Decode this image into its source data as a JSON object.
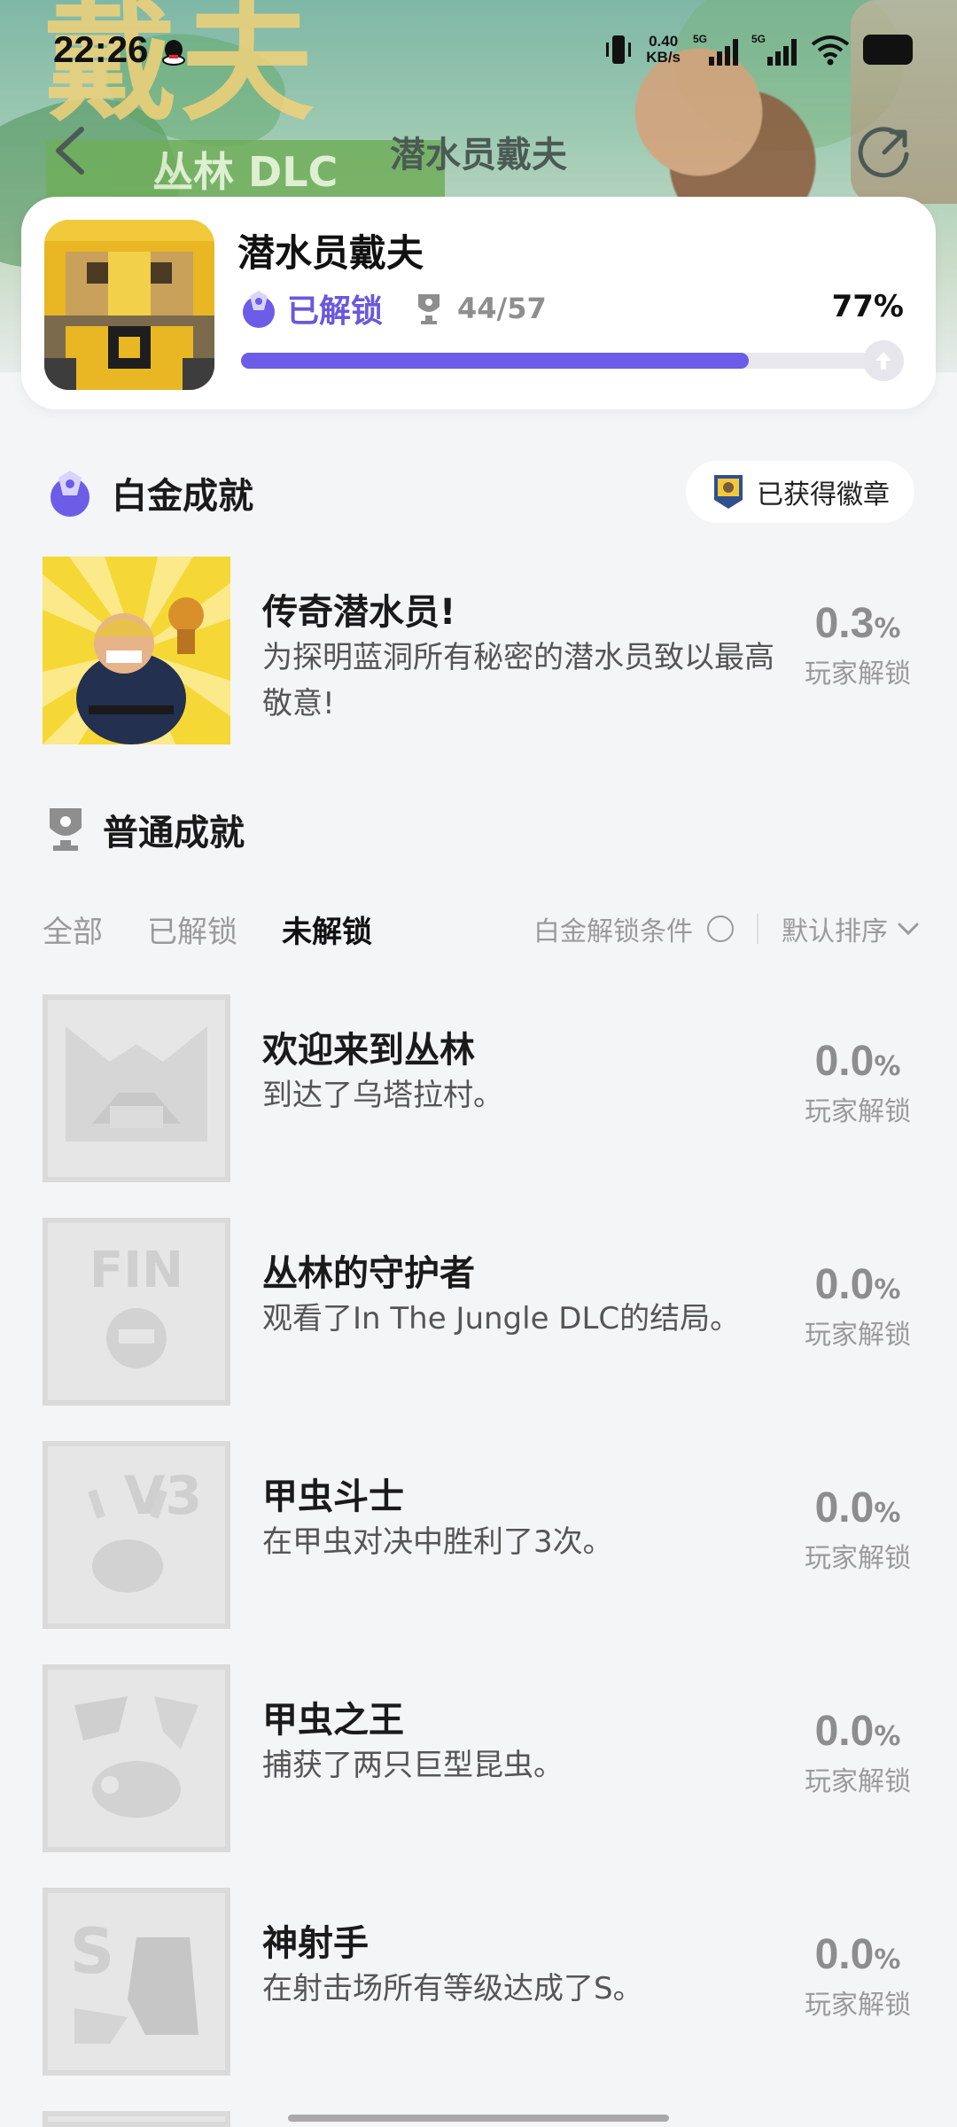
{
  "status_bar": {
    "time": "22:26",
    "net_speed_value": "0.40",
    "net_speed_unit": "KB/s",
    "sim1": "5G",
    "sim2": "5G"
  },
  "banner": {
    "logo_text": "戴夫",
    "dlc_label": "丛林 DLC"
  },
  "nav": {
    "title": "潜水员戴夫",
    "back_icon": "chevron-left-icon",
    "share_icon": "share-icon"
  },
  "game": {
    "name": "潜水员戴夫",
    "unlock_label": "已解锁",
    "unlock_count": "44/57",
    "unlock_percent": "77%",
    "progress": 0.77
  },
  "platinum": {
    "section_title": "白金成就",
    "badge_button": "已获得徽章",
    "item": {
      "title": "传奇潜水员!",
      "desc": "为探明蓝洞所有秘密的潜水员致以最高敬意!",
      "rate": "0.3",
      "rate_unit": "%",
      "rate_label": "玩家解锁"
    }
  },
  "normal": {
    "section_title": "普通成就",
    "tabs": [
      "全部",
      "已解锁",
      "未解锁"
    ],
    "active_tab": 2,
    "condition_label": "白金解锁条件",
    "sort_label": "默认排序",
    "items": [
      {
        "title": "欢迎来到丛林",
        "desc": "到达了乌塔拉村。",
        "rate": "0.0",
        "rate_unit": "%",
        "rate_label": "玩家解锁",
        "icon_text": ""
      },
      {
        "title": "丛林的守护者",
        "desc": "观看了In The Jungle DLC的结局。",
        "rate": "0.0",
        "rate_unit": "%",
        "rate_label": "玩家解锁",
        "icon_text": "FIN"
      },
      {
        "title": "甲虫斗士",
        "desc": "在甲虫对决中胜利了3次。",
        "rate": "0.0",
        "rate_unit": "%",
        "rate_label": "玩家解锁",
        "icon_text": "V3"
      },
      {
        "title": "甲虫之王",
        "desc": "捕获了两只巨型昆虫。",
        "rate": "0.0",
        "rate_unit": "%",
        "rate_label": "玩家解锁",
        "icon_text": ""
      },
      {
        "title": "神射手",
        "desc": "在射击场所有等级达成了S。",
        "rate": "0.0",
        "rate_unit": "%",
        "rate_label": "玩家解锁",
        "icon_text": "S"
      }
    ]
  },
  "colors": {
    "accent": "#6c5ce7",
    "unlock_text": "#6a58dc",
    "background": "#f4f5f7"
  }
}
